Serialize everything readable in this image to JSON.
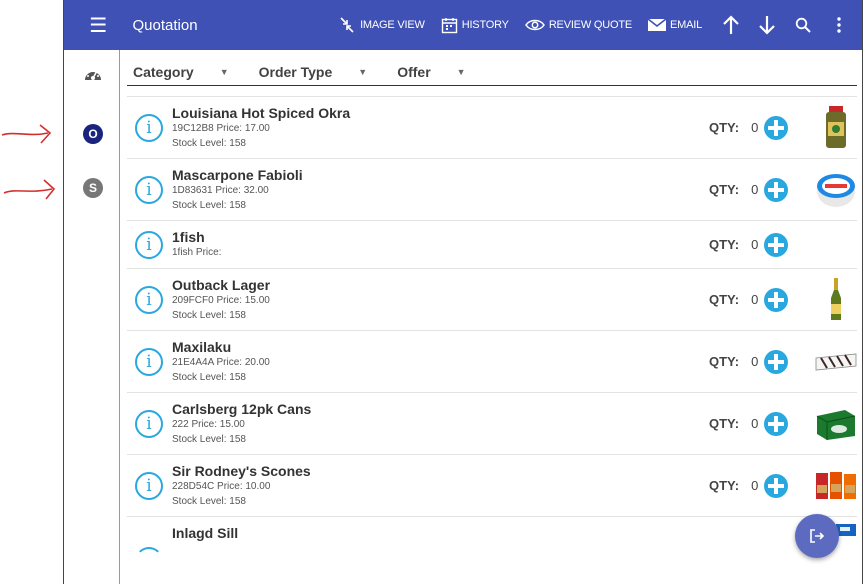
{
  "appbar": {
    "title": "Quotation",
    "image_view": "IMAGE VIEW",
    "history": "HISTORY",
    "review_quote": "REVIEW QUOTE",
    "email": "EMAIL",
    "color": "#3f51b5"
  },
  "rail": {
    "item_o": "O",
    "item_s": "S"
  },
  "filters": {
    "category": "Category",
    "order_type": "Order Type",
    "offer": "Offer"
  },
  "products": [
    {
      "name": "Louisiana Hot Spiced Okra",
      "code_price": "19C12B8  Price: 17.00",
      "stock": "Stock Level: 158",
      "qty_label": "QTY:",
      "qty": "0",
      "thumb": "jar"
    },
    {
      "name": "Mascarpone Fabioli",
      "code_price": "1D83631  Price: 32.00",
      "stock": "Stock Level: 158",
      "qty_label": "QTY:",
      "qty": "0",
      "thumb": "tub"
    },
    {
      "name": "1fish",
      "code_price": "1fish  Price:",
      "stock": "",
      "qty_label": "QTY:",
      "qty": "0",
      "thumb": ""
    },
    {
      "name": "Outback Lager",
      "code_price": "209FCF0  Price: 15.00",
      "stock": "Stock Level: 158",
      "qty_label": "QTY:",
      "qty": "0",
      "thumb": "bottle"
    },
    {
      "name": "Maxilaku",
      "code_price": "21E4A4A  Price: 20.00",
      "stock": "Stock Level: 158",
      "qty_label": "QTY:",
      "qty": "0",
      "thumb": "wafers"
    },
    {
      "name": "Carlsberg 12pk Cans",
      "code_price": "222  Price: 15.00",
      "stock": "Stock Level: 158",
      "qty_label": "QTY:",
      "qty": "0",
      "thumb": "cans"
    },
    {
      "name": "Sir Rodney's Scones",
      "code_price": "228D54C  Price: 10.00",
      "stock": "Stock Level: 158",
      "qty_label": "QTY:",
      "qty": "0",
      "thumb": "scones"
    },
    {
      "name": "Inlagd Sill",
      "code_price": "",
      "stock": "",
      "qty_label": "",
      "qty": "",
      "thumb": ""
    }
  ],
  "icons": [
    "menu-icon",
    "image-view-icon",
    "history-icon",
    "eye-icon",
    "email-icon",
    "arrow-up-icon",
    "arrow-down-icon",
    "search-icon",
    "more-vert-icon",
    "dashboard-icon",
    "info-icon",
    "add-circle-icon",
    "exit-icon"
  ]
}
